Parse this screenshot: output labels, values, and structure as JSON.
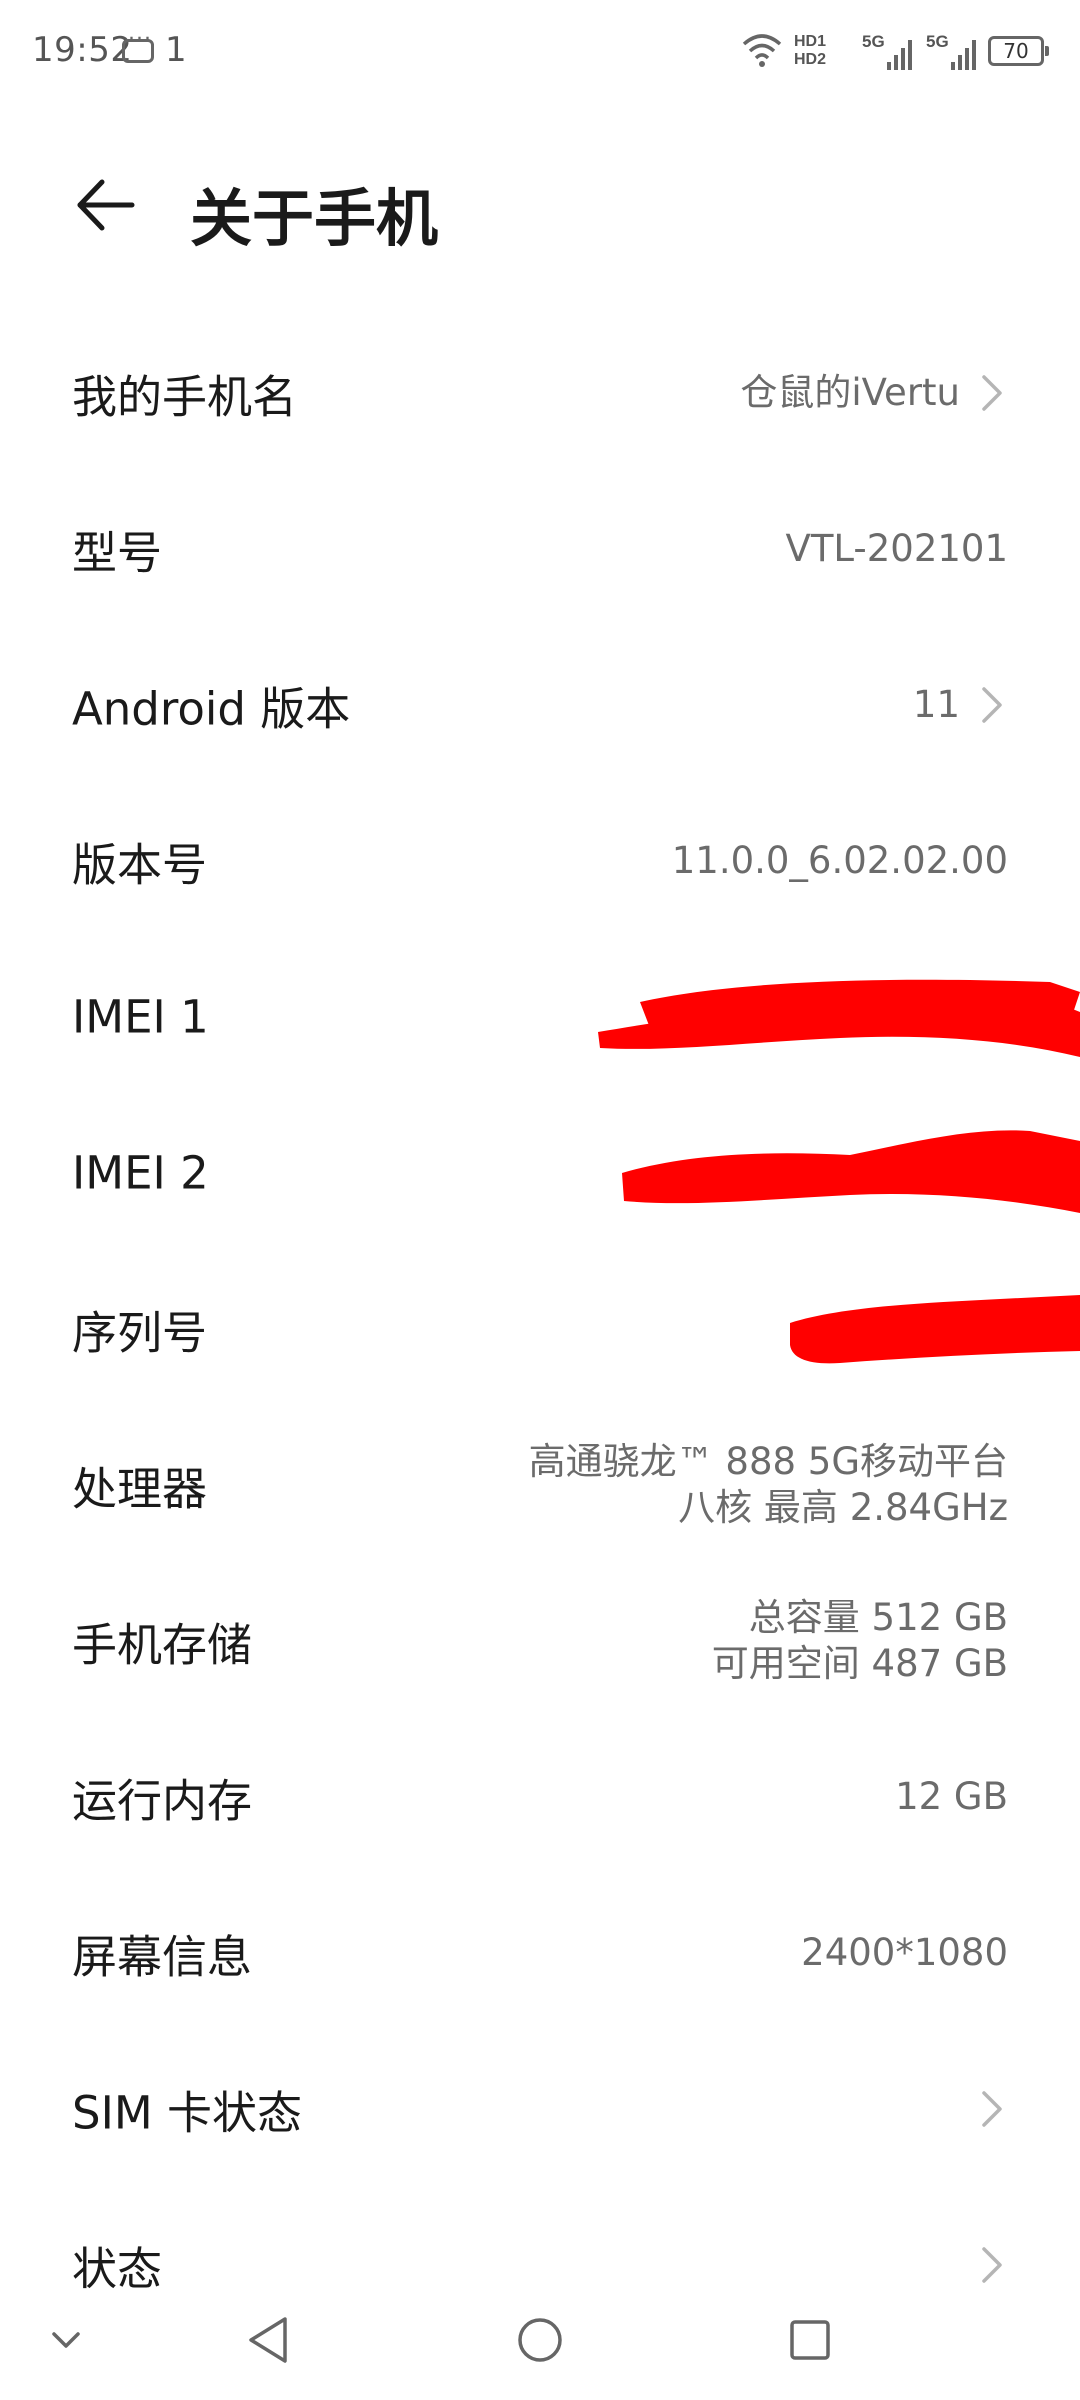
{
  "status_bar": {
    "time": "19:52",
    "notification_count": "1",
    "hd_labels": [
      "HD1",
      "HD2"
    ],
    "signal_labels": [
      "5G",
      "5G"
    ],
    "battery": "70"
  },
  "header": {
    "title": "关于手机",
    "back_icon": "arrow-left-icon"
  },
  "rows": [
    {
      "label": "我的手机名",
      "value": "仓鼠的iVertu",
      "chevron": true
    },
    {
      "label": "型号",
      "value": "VTL-202101",
      "chevron": false
    },
    {
      "label": "Android 版本",
      "value": "11",
      "chevron": true
    },
    {
      "label": "版本号",
      "value": "11.0.0_6.02.02.00",
      "chevron": false
    },
    {
      "label": "IMEI 1",
      "value": "",
      "redacted": true
    },
    {
      "label": "IMEI 2",
      "value": "",
      "redacted": true
    },
    {
      "label": "序列号",
      "value": "",
      "redacted": true
    },
    {
      "label": "处理器",
      "value_lines": [
        "高通骁龙™ 888 5G移动平台",
        "八核 最高 2.84GHz"
      ]
    },
    {
      "label": "手机存储",
      "value_lines": [
        "总容量 512 GB",
        "可用空间 487 GB"
      ]
    },
    {
      "label": "运行内存",
      "value": "12 GB",
      "chevron": false
    },
    {
      "label": "屏幕信息",
      "value": "2400*1080",
      "chevron": false
    },
    {
      "label": "SIM 卡状态",
      "value": "",
      "chevron": true
    },
    {
      "label": "状态",
      "value": "",
      "chevron": true
    }
  ],
  "nav_bar": {
    "icons": [
      "chevron-down-icon",
      "back-triangle-icon",
      "home-circle-icon",
      "recents-square-icon"
    ]
  },
  "colors": {
    "redaction": "#ff0000",
    "secondary_text": "#6b6b6b",
    "chevron": "#b5b5b5"
  }
}
